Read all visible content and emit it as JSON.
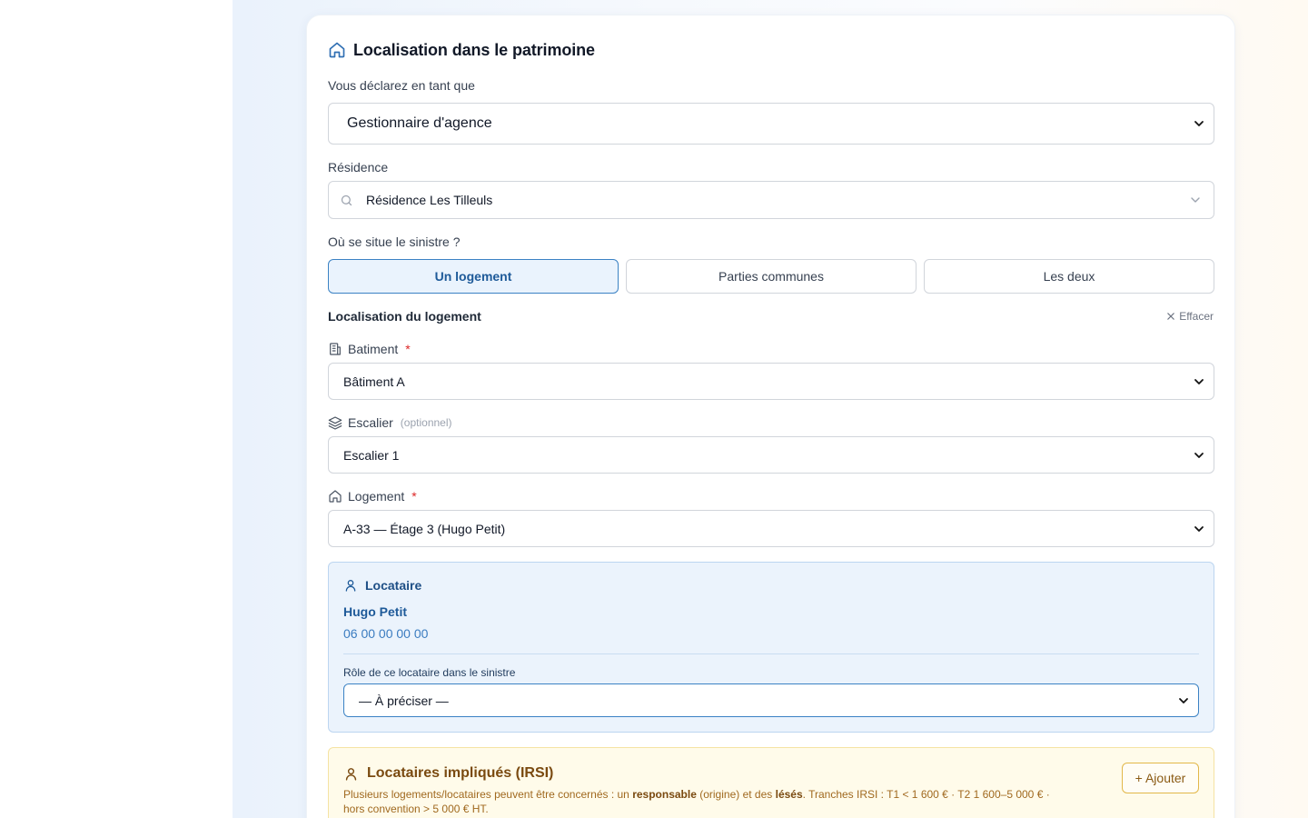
{
  "section": {
    "title": "Localisation dans le patrimoine",
    "icon": "home-icon"
  },
  "declarant": {
    "label": "Vous déclarez en tant que",
    "value": "Gestionnaire d'agence"
  },
  "residence": {
    "label": "Résidence",
    "value": "Résidence Les Tilleuls"
  },
  "location_question": {
    "label": "Où se situe le sinistre ?",
    "options": [
      "Un logement",
      "Parties communes",
      "Les deux"
    ],
    "selected": "Un logement"
  },
  "unit_location": {
    "title": "Localisation du logement",
    "clear_label": "Effacer",
    "building": {
      "label": "Batiment",
      "required_mark": "*",
      "value": "Bâtiment A"
    },
    "staircase": {
      "label": "Escalier",
      "optional_label": "(optionnel)",
      "value": "Escalier 1"
    },
    "unit": {
      "label": "Logement",
      "required_mark": "*",
      "value": "A-33 — Étage 3 (Hugo Petit)"
    }
  },
  "tenant": {
    "title": "Locataire",
    "name": "Hugo Petit",
    "phone": "06 00 00 00 00",
    "role_label": "Rôle de ce locataire dans le sinistre",
    "role_value": "— À préciser —"
  },
  "irsi": {
    "title": "Locataires impliqués (IRSI)",
    "add_label": "+ Ajouter",
    "desc_1": "Plusieurs logements/locataires peuvent être concernés : un ",
    "desc_bold_1": "responsable",
    "desc_2": " (origine) et des ",
    "desc_bold_2": "lésés",
    "desc_3": ". Tranches IRSI : T1 < 1 600 € · T2 1 600–5 000 € ·",
    "desc_4": "hors convention > 5 000 € HT."
  },
  "colors": {
    "accent": "#1e5a99",
    "active_border": "#3b82c4",
    "tenant_bg": "#ebf3fc",
    "irsi_bg": "#fffbea",
    "irsi_text": "#8a5a13",
    "required": "#dc2626"
  }
}
